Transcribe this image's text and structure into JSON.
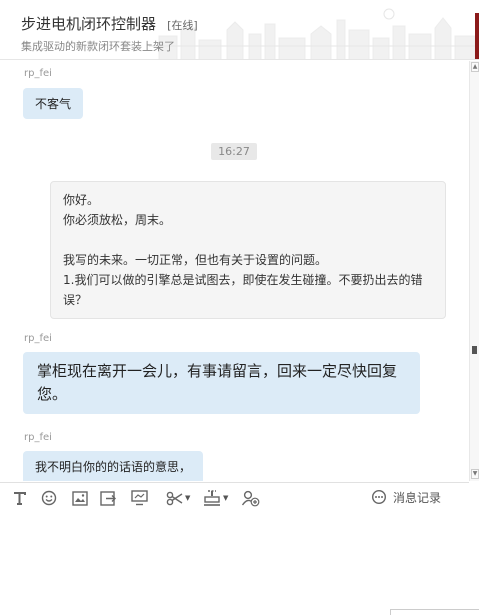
{
  "header": {
    "title": "步进电机闭环控制器",
    "status": "[在线]",
    "subtitle": "集成驱动的新款闭环套装上架了",
    "accent_color": "#8b1a1a"
  },
  "chat": {
    "messages": {
      "m1": {
        "sender": "rp_fei",
        "text": "不客气"
      },
      "time": "16:27",
      "m2": {
        "line1": "你好。",
        "line2": "你必须放松，周末。",
        "line3": "我写的未来。一切正常，但也有关于设置的问题。",
        "line4": "1.我们可以做的引擎总是试图去，即使在发生碰撞。不要扔出去的错误？"
      },
      "m3": {
        "sender": "rp_fei",
        "text": "掌柜现在离开一会儿，有事请留言，回来一定尽快回复您。"
      },
      "m4": {
        "sender": "rp_fei",
        "text": "我不明白你的的话语的意思，"
      }
    },
    "bubble_color": "#dcebf7"
  },
  "toolbar": {
    "icons": [
      "font-icon",
      "emoji-icon",
      "image-icon",
      "send-file-icon",
      "screen-share-icon",
      "scissors-icon",
      "stamp-icon",
      "add-contact-icon"
    ],
    "history_label": "消息记录"
  },
  "input": {
    "value": ""
  }
}
